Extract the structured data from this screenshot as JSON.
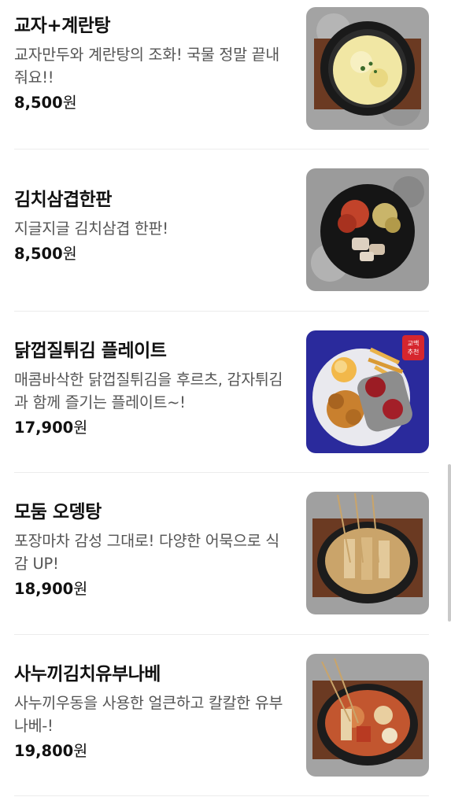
{
  "menu": {
    "items": [
      {
        "name": "교자+계란탕",
        "desc": "교자만두와 계란탕의 조화! 국물 정말 끝내줘요!!",
        "price": "8,500",
        "currency": "원",
        "image_icon": "egg-soup-dumpling-photo"
      },
      {
        "name": "김치삼겹한판",
        "desc": "지글지글 김치삼겹 한판!",
        "price": "8,500",
        "currency": "원",
        "image_icon": "kimchi-pork-belly-photo"
      },
      {
        "name": "닭껍질튀김 플레이트",
        "desc": "매콤바삭한 닭껍질튀김을 후르츠, 감자튀김과 함께 즐기는 플레이트~!",
        "price": "17,900",
        "currency": "원",
        "image_icon": "chicken-skin-plate-photo",
        "badge": "교맥 추천"
      },
      {
        "name": "모둠 오뎅탕",
        "desc": "포장마차 감성 그대로! 다양한 어묵으로 식감 UP!",
        "price": "18,900",
        "currency": "원",
        "image_icon": "fish-cake-soup-photo"
      },
      {
        "name": "사누끼김치유부나베",
        "desc": "사누끼우동을 사용한 얼큰하고 칼칼한 유부나베-!",
        "price": "19,800",
        "currency": "원",
        "image_icon": "kimchi-udon-nabe-photo"
      }
    ]
  },
  "colors": {
    "text": "#111111",
    "desc": "#555555",
    "divider": "#ececec",
    "badge_bg": "#2a2a9c"
  }
}
